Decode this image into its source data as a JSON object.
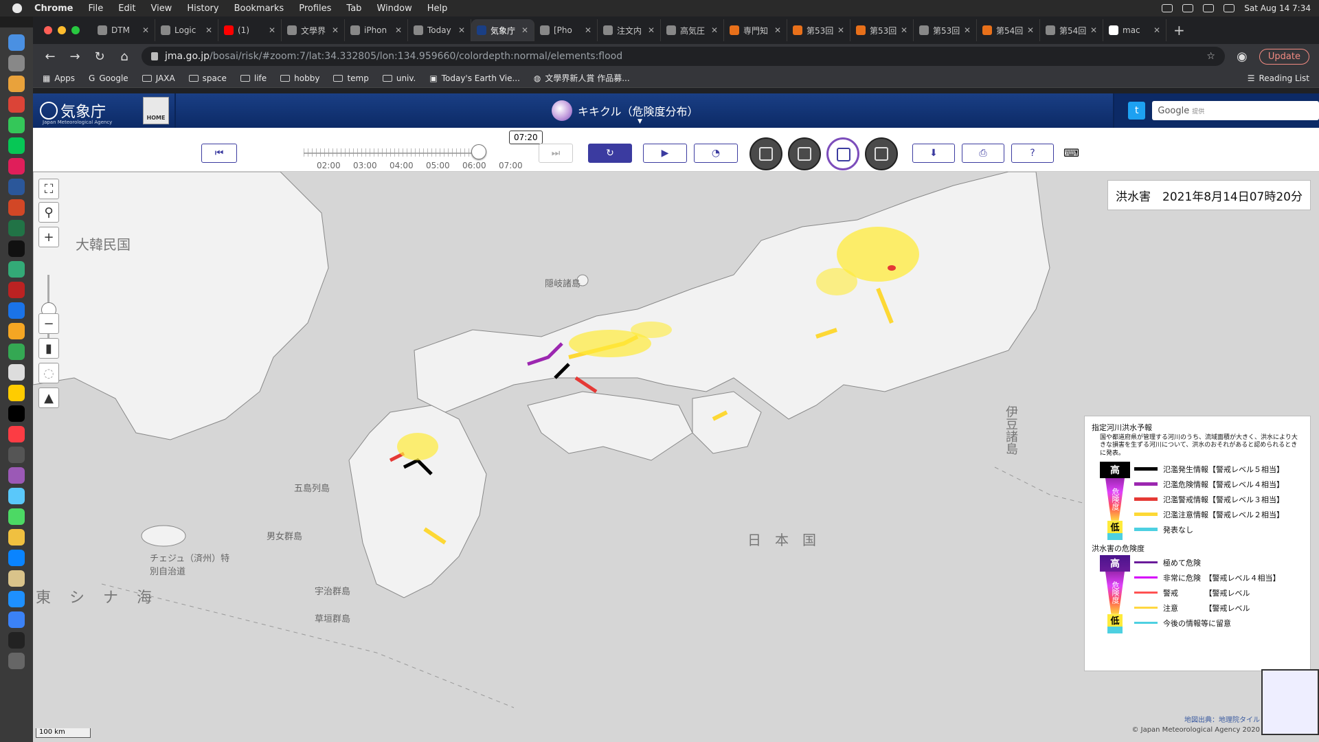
{
  "menubar": {
    "app": "Chrome",
    "items": [
      "File",
      "Edit",
      "View",
      "History",
      "Bookmarks",
      "Profiles",
      "Tab",
      "Window",
      "Help"
    ],
    "datetime": "Sat Aug 14  7:34"
  },
  "tabs": [
    {
      "title": "DTM"
    },
    {
      "title": "Logic"
    },
    {
      "title": "(1)"
    },
    {
      "title": "文學界"
    },
    {
      "title": "iPhon"
    },
    {
      "title": "Today"
    },
    {
      "title": "気象庁",
      "active": true
    },
    {
      "title": "[Pho"
    },
    {
      "title": "注文内"
    },
    {
      "title": "高気圧"
    },
    {
      "title": "専門知"
    },
    {
      "title": "第53回"
    },
    {
      "title": "第53回"
    },
    {
      "title": "第53回"
    },
    {
      "title": "第54回"
    },
    {
      "title": "第54回"
    },
    {
      "title": "mac"
    }
  ],
  "toolbar": {
    "url_host": "jma.go.jp",
    "url_path": "/bosai/risk/#zoom:7/lat:34.332805/lon:134.959660/colordepth:normal/elements:flood",
    "update_label": "Update"
  },
  "bookmarks": {
    "items": [
      "Apps",
      "Google",
      "JAXA",
      "space",
      "life",
      "hobby",
      "temp",
      "univ.",
      "Today's Earth Vie...",
      "文學界新人賞 作品募..."
    ],
    "reading_list": "Reading List"
  },
  "header": {
    "logo_name": "気象庁",
    "logo_sub": "Japan Meteorological Agency",
    "home_label": "HOME",
    "title": "キキクル（危険度分布）",
    "search_brand": "Google",
    "search_sub": "提供"
  },
  "timeline": {
    "current_time": "07:20",
    "ticks": [
      "02:00",
      "03:00",
      "04:00",
      "05:00",
      "06:00",
      "07:00"
    ],
    "position_fraction": 0.96
  },
  "map": {
    "title": "洪水害　2021年8月14日07時20分",
    "labels": {
      "korea": "大韓民国",
      "sea_japan": "日　本　国",
      "east_china_sea": "東 シ ナ 海",
      "oki": "隠岐諸島",
      "izu": "伊豆諸島",
      "jeju": "チェジュ（済州）特別自治道",
      "goto": "五島列島",
      "danjo": "男女群島",
      "uji": "宇治群島",
      "kusagaki": "草垣群島"
    },
    "scale": "100 km",
    "attribution": "地図出典：地理院タイル",
    "copyright": "© Japan Meteorological Agency 2020"
  },
  "legend": {
    "sec1_title": "指定河川洪水予報",
    "sec1_desc": "国や都道府県が管理する河川のうち、流域面積が大きく、洪水により大きな損害を生ずる河川について、洪水のおそれがあると認められるときに発表。",
    "sec1_rows": [
      {
        "label": "氾濫発生情報【警戒レベル５相当】",
        "color": "#000000"
      },
      {
        "label": "氾濫危険情報【警戒レベル４相当】",
        "color": "#9c27b0"
      },
      {
        "label": "氾濫警戒情報【警戒レベル３相当】",
        "color": "#e53935"
      },
      {
        "label": "氾濫注意情報【警戒レベル２相当】",
        "color": "#fdd835"
      },
      {
        "label": "発表なし",
        "color": "#4dd0e1"
      }
    ],
    "sec2_title": "洪水害の危険度",
    "sec2_rows": [
      {
        "label": "極めて危険",
        "color": "#6a1b9a"
      },
      {
        "label": "非常に危険　【警戒レベル４相当】",
        "color": "#d500f9"
      },
      {
        "label": "警戒　　　　【警戒レベル",
        "color": "#ff5252"
      },
      {
        "label": "注意　　　　【警戒レベル",
        "color": "#ffd740"
      },
      {
        "label": "今後の情報等に留意",
        "color": "#4dd0e1"
      }
    ],
    "high": "高",
    "low": "低",
    "danger": "危険度"
  }
}
